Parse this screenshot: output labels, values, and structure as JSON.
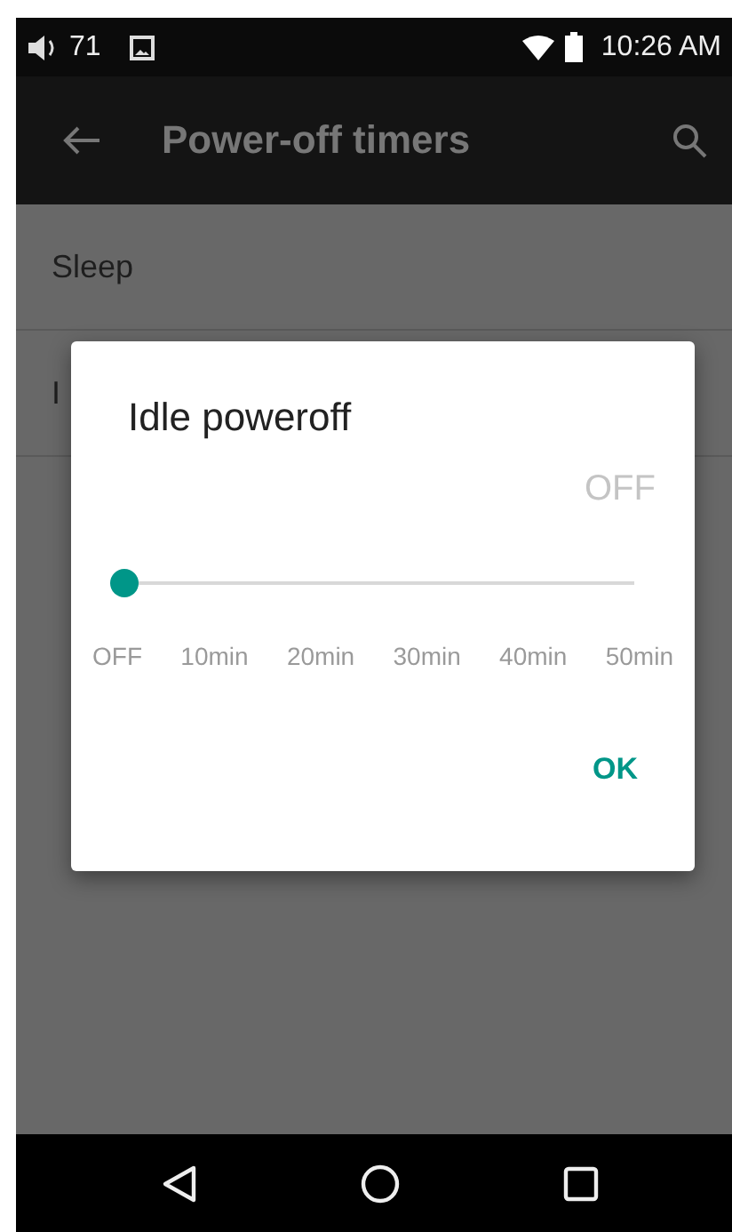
{
  "status_bar": {
    "volume": "71",
    "time": "10:26 AM"
  },
  "app_bar": {
    "title": "Power-off timers"
  },
  "list": [
    {
      "label": "Sleep"
    },
    {
      "label": "I"
    }
  ],
  "dialog": {
    "title": "Idle poweroff",
    "reading": "OFF",
    "slider": {
      "level": 0
    },
    "ticks": [
      "OFF",
      "10min",
      "20min",
      "30min",
      "40min",
      "50min"
    ],
    "buttons": [
      "OK"
    ]
  }
}
